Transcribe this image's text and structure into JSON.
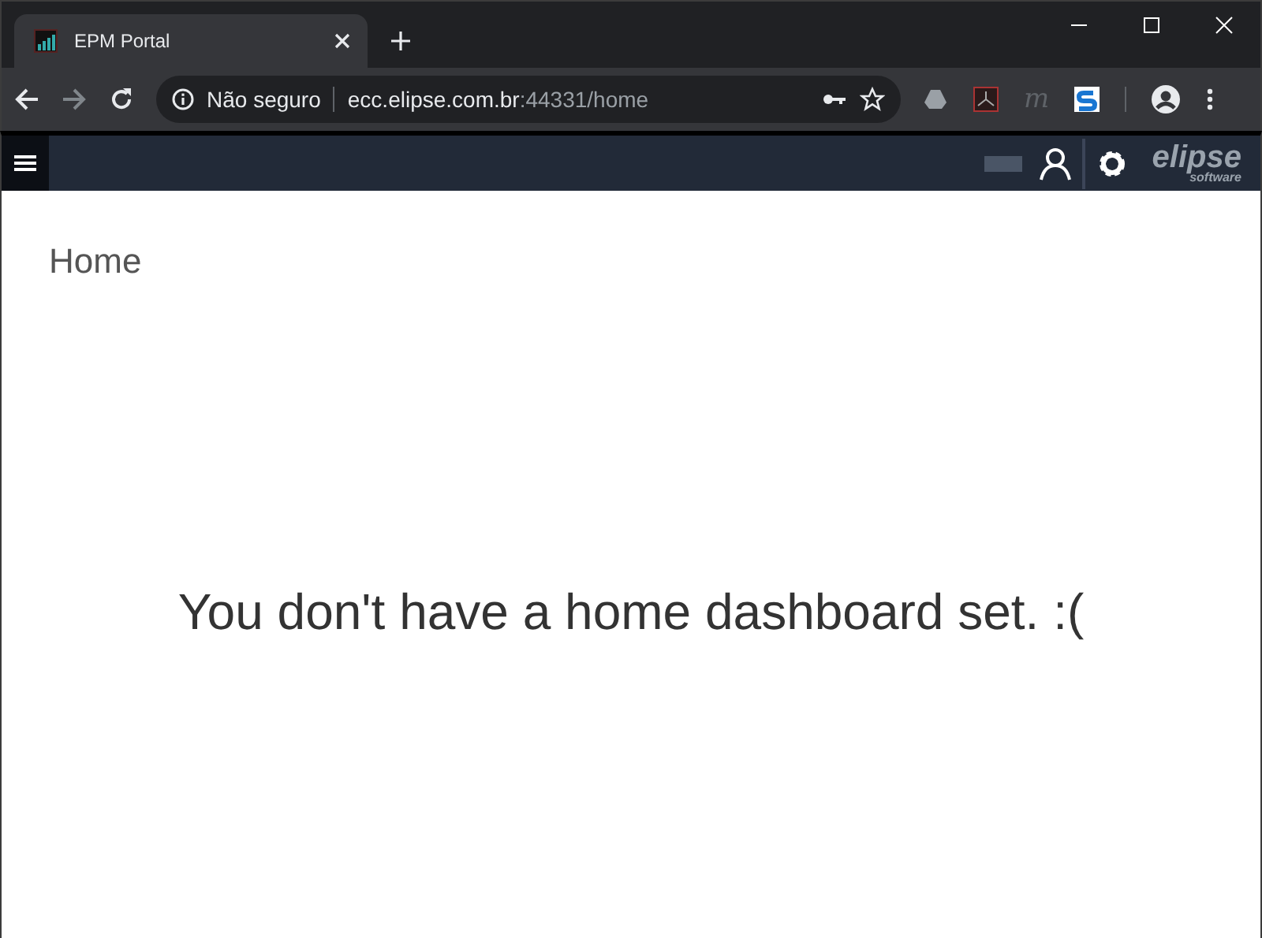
{
  "browser": {
    "tabs": [
      {
        "title": "EPM Portal",
        "selected": true
      }
    ],
    "address": {
      "security": "Não seguro",
      "host": "ecc.elipse.com.br",
      "path": ":44331/home"
    },
    "extension_letter": "m"
  },
  "app": {
    "logo": {
      "name": "elipse",
      "sub": "software"
    },
    "page_title": "Home",
    "message": "You don't have a home dashboard set. :("
  }
}
